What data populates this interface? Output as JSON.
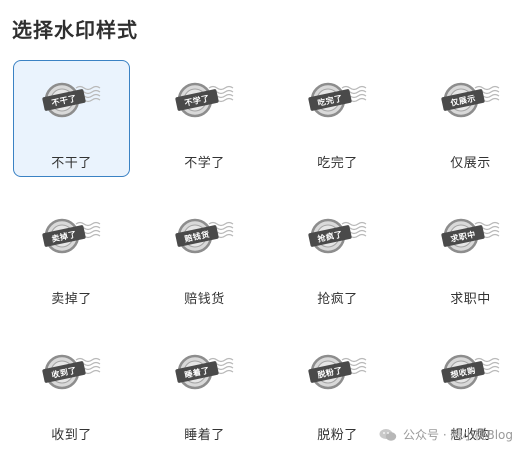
{
  "header": {
    "title": "选择水印样式"
  },
  "styles": [
    {
      "label": "不干了",
      "stamp_text": "不干了",
      "selected": true
    },
    {
      "label": "不学了",
      "stamp_text": "不学了",
      "selected": false
    },
    {
      "label": "吃完了",
      "stamp_text": "吃完了",
      "selected": false
    },
    {
      "label": "仅展示",
      "stamp_text": "仅展示",
      "selected": false
    },
    {
      "label": "卖掉了",
      "stamp_text": "卖掉了",
      "selected": false
    },
    {
      "label": "赔钱货",
      "stamp_text": "赔钱货",
      "selected": false
    },
    {
      "label": "抢疯了",
      "stamp_text": "抢疯了",
      "selected": false
    },
    {
      "label": "求职中",
      "stamp_text": "求职中",
      "selected": false
    },
    {
      "label": "收到了",
      "stamp_text": "收到了",
      "selected": false
    },
    {
      "label": "睡着了",
      "stamp_text": "睡着了",
      "selected": false
    },
    {
      "label": "脱粉了",
      "stamp_text": "脱粉了",
      "selected": false
    },
    {
      "label": "想收购",
      "stamp_text": "想收购",
      "selected": false
    }
  ],
  "watermark": {
    "text": "公众号 · 陶小桃Blog",
    "icon": "wechat-icon"
  },
  "colors": {
    "selected_border": "#3b82c4",
    "selected_bg": "#eaf3fd",
    "stamp_dark": "#4a4a4a",
    "stamp_light": "#d9d9d9"
  }
}
